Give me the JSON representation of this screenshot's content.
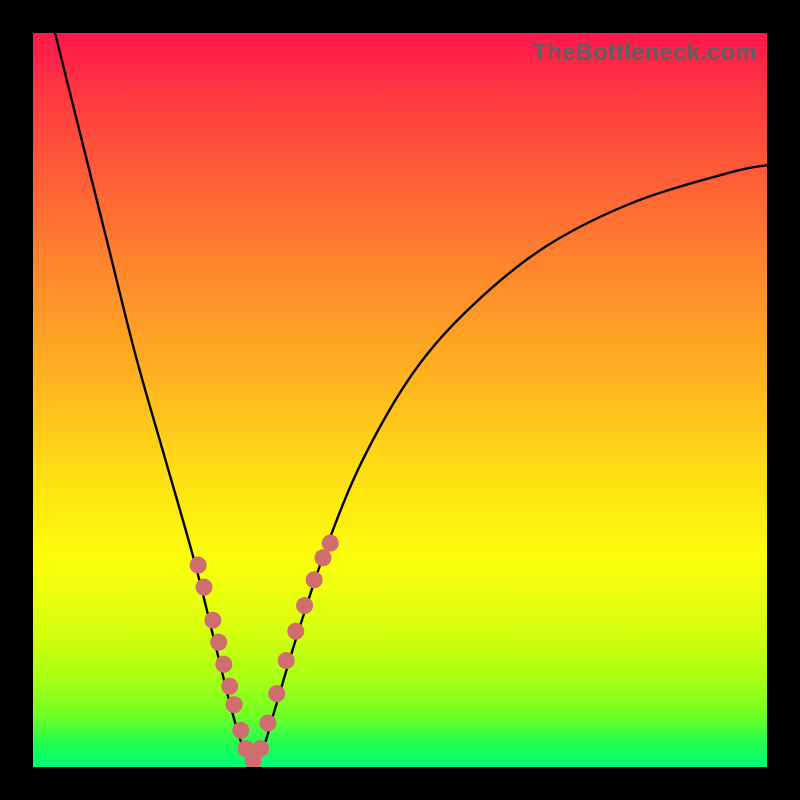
{
  "watermark": "TheBottleneck.com",
  "chart_data": {
    "type": "line",
    "title": "",
    "xlabel": "",
    "ylabel": "",
    "xlim": [
      0,
      100
    ],
    "ylim": [
      0,
      100
    ],
    "series": [
      {
        "name": "bottleneck-curve",
        "x": [
          3,
          6,
          10,
          14,
          18,
          22,
          25,
          27,
          28.5,
          30,
          31.5,
          33,
          36,
          40,
          45,
          52,
          60,
          70,
          82,
          95,
          100
        ],
        "y": [
          100,
          88,
          72,
          56,
          42,
          28,
          16,
          8,
          3,
          0.5,
          3,
          8,
          18,
          30,
          42,
          54,
          63,
          71,
          77,
          81,
          82
        ]
      }
    ],
    "markers": {
      "name": "highlight-points",
      "color": "#cf6d6f",
      "x": [
        22.5,
        23.3,
        24.5,
        25.3,
        26.0,
        26.8,
        27.4,
        28.3,
        29.0,
        30.0,
        31.0,
        32.0,
        33.2,
        34.5,
        35.8,
        37.0,
        38.3,
        39.5,
        40.5
      ],
      "y": [
        27.5,
        24.5,
        20.0,
        17.0,
        14.0,
        11.0,
        8.5,
        5.0,
        2.5,
        0.8,
        2.5,
        6.0,
        10.0,
        14.5,
        18.5,
        22.0,
        25.5,
        28.5,
        30.5
      ]
    }
  }
}
